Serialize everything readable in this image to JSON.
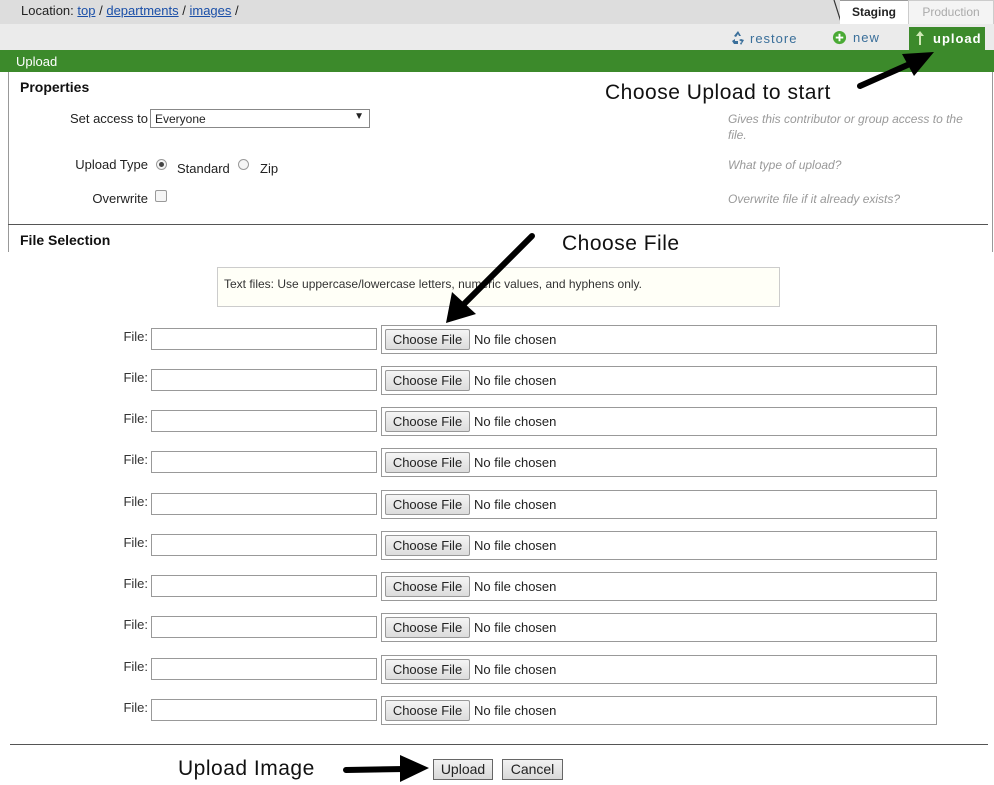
{
  "breadcrumb": {
    "prefix": "Location:",
    "items": [
      "top",
      "departments",
      "images"
    ],
    "sep": "/"
  },
  "env_tabs": {
    "staging": "Staging",
    "production": "Production"
  },
  "actions": {
    "restore": "restore",
    "new": "new",
    "upload": "upload"
  },
  "panel": {
    "title": "Upload"
  },
  "properties": {
    "title": "Properties",
    "access_label": "Set access to",
    "access_value": "Everyone",
    "access_help": "Gives this contributor or group access to the file.",
    "upload_type_label": "Upload Type",
    "upload_type_options": [
      "Standard",
      "Zip"
    ],
    "upload_type_selected": "Standard",
    "upload_type_help": "What type of upload?",
    "overwrite_label": "Overwrite",
    "overwrite_checked": false,
    "overwrite_help": "Overwrite file if it already exists?"
  },
  "file_selection": {
    "title": "File Selection",
    "notice": "Text files: Use uppercase/lowercase letters, numeric values, and hyphens only.",
    "row_label": "File:",
    "choose_label": "Choose File",
    "no_file_text": "No file chosen"
  },
  "buttons": {
    "upload": "Upload",
    "cancel": "Cancel"
  },
  "annotations": {
    "upload_start": "Choose Upload to start",
    "choose_file": "Choose File",
    "upload_image": "Upload Image"
  },
  "colors": {
    "green": "#3c8a2b",
    "link": "#1a4fa8",
    "action": "#3a6f9a"
  }
}
